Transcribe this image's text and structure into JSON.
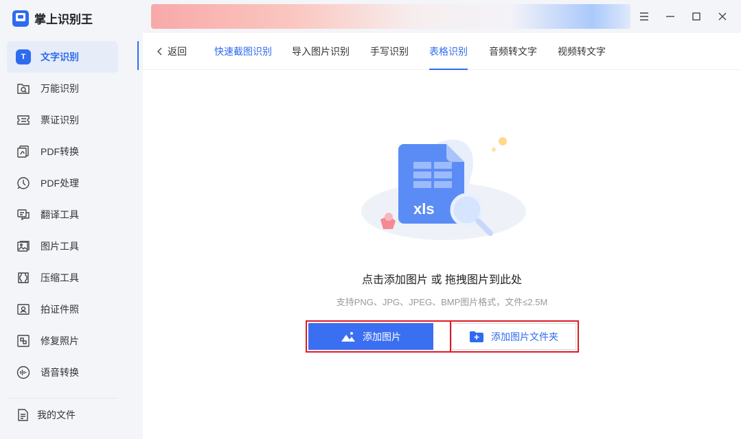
{
  "app": {
    "name": "掌上识别王"
  },
  "sidebar": {
    "items": [
      {
        "label": "文字识别",
        "icon": "text-recognition-icon",
        "active": true
      },
      {
        "label": "万能识别",
        "icon": "universal-scan-icon"
      },
      {
        "label": "票证识别",
        "icon": "ticket-icon"
      },
      {
        "label": "PDF转换",
        "icon": "pdf-convert-icon"
      },
      {
        "label": "PDF处理",
        "icon": "pdf-process-icon"
      },
      {
        "label": "翻译工具",
        "icon": "translate-icon"
      },
      {
        "label": "图片工具",
        "icon": "image-tools-icon"
      },
      {
        "label": "压缩工具",
        "icon": "compress-icon"
      },
      {
        "label": "拍证件照",
        "icon": "id-photo-icon"
      },
      {
        "label": "修复照片",
        "icon": "repair-photo-icon"
      },
      {
        "label": "语音转换",
        "icon": "voice-convert-icon"
      }
    ],
    "my_files": "我的文件"
  },
  "active_icon_letter": "T",
  "tabs": {
    "back": "返回",
    "items": [
      {
        "label": "快速截图识别",
        "style": "blue"
      },
      {
        "label": "导入图片识别"
      },
      {
        "label": "手写识别"
      },
      {
        "label": "表格识别",
        "active": true
      },
      {
        "label": "音频转文字"
      },
      {
        "label": "视频转文字"
      }
    ]
  },
  "illustration": {
    "file_type": "xls"
  },
  "drop_zone": {
    "title": "点击添加图片 或 拖拽图片到此处",
    "subtitle": "支持PNG、JPG、JPEG、BMP图片格式，文件≤2.5M"
  },
  "buttons": {
    "add_image": "添加图片",
    "add_folder": "添加图片文件夹"
  },
  "colors": {
    "accent": "#2f6bf0",
    "highlight": "#e0181f"
  }
}
